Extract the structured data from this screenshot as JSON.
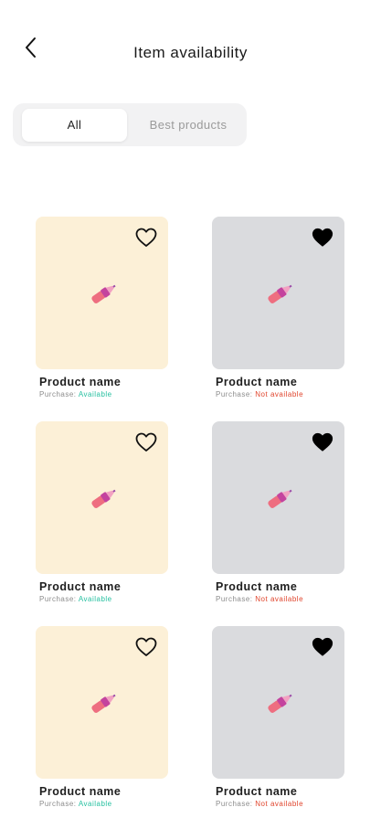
{
  "header": {
    "title": "Item availability"
  },
  "tabs": [
    {
      "label": "All",
      "active": true
    },
    {
      "label": "Best products",
      "active": false
    }
  ],
  "colors": {
    "available": "#25c0a0",
    "not_available": "#e0452d",
    "card_yellow": "#fcf0d7",
    "card_gray": "#dadbde"
  },
  "products": [
    {
      "name": "Product name",
      "purchase_label": "Purchase:",
      "status": "Available",
      "favorited": false,
      "icon": "lipstick-icon"
    },
    {
      "name": "Product name",
      "purchase_label": "Purchase:",
      "status": "Not available",
      "favorited": true,
      "icon": "lipstick-icon"
    },
    {
      "name": "Product name",
      "purchase_label": "Purchase:",
      "status": "Available",
      "favorited": false,
      "icon": "lipstick-icon"
    },
    {
      "name": "Product name",
      "purchase_label": "Purchase:",
      "status": "Not available",
      "favorited": true,
      "icon": "lipstick-icon"
    },
    {
      "name": "Product name",
      "purchase_label": "Purchase:",
      "status": "Available",
      "favorited": false,
      "icon": "lipstick-icon"
    },
    {
      "name": "Product name",
      "purchase_label": "Purchase:",
      "status": "Not available",
      "favorited": true,
      "icon": "lipstick-icon"
    }
  ]
}
